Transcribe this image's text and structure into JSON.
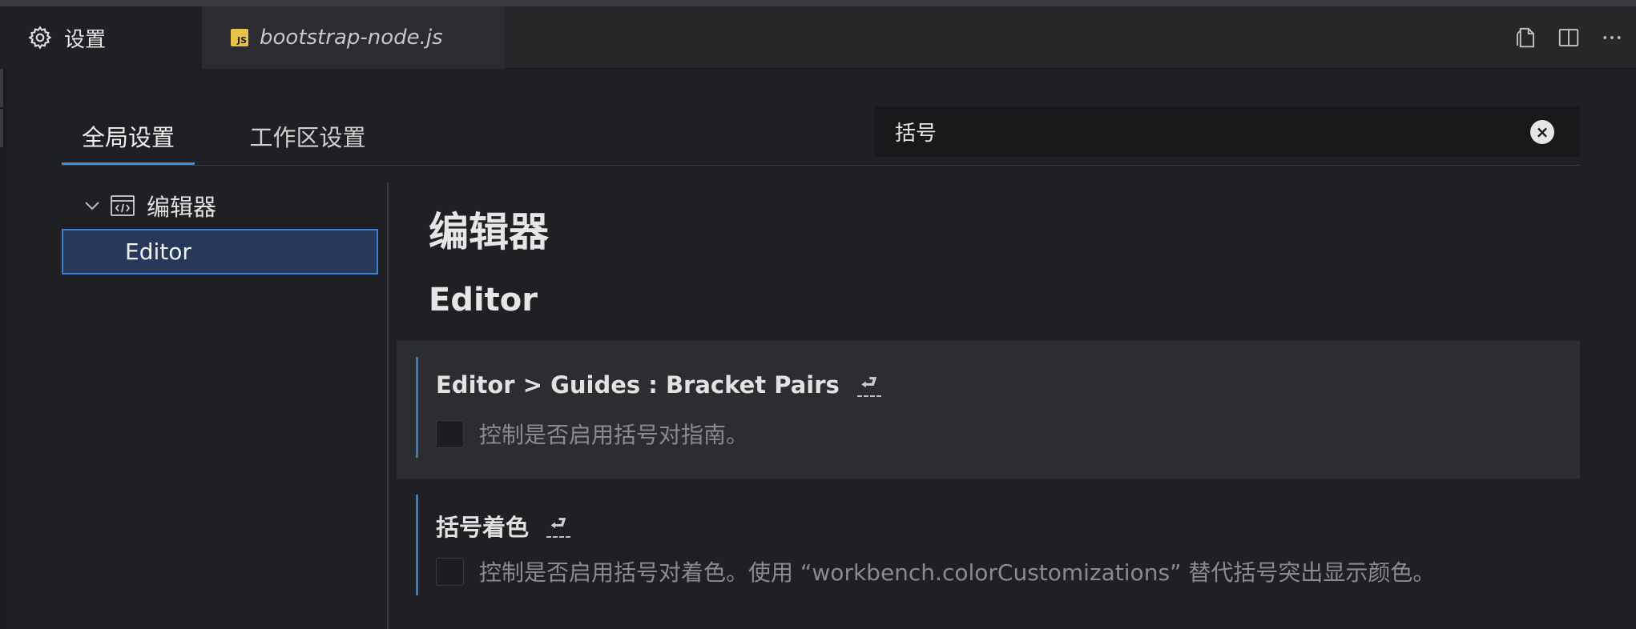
{
  "tabs": {
    "settings_label": "设置",
    "file_label": "bootstrap-node.js",
    "file_badge": "JS"
  },
  "scope": {
    "global": "全局设置",
    "workspace": "工作区设置"
  },
  "search": {
    "value": "括号",
    "clear_icon": "×"
  },
  "toc": {
    "group_label": "编辑器",
    "item_label": "Editor"
  },
  "content": {
    "category": "编辑器",
    "section": "Editor",
    "settings": [
      {
        "title": "Editor > Guides : Bracket Pairs",
        "description": "控制是否启用括号对指南。",
        "checked": false
      },
      {
        "title": "括号着色",
        "description": "控制是否启用括号对着色。使用 “workbench.colorCustomizations” 替代括号突出显示颜色。",
        "checked": false
      }
    ]
  },
  "colors": {
    "accent": "#3b8eea",
    "selected_bg": "#27395a",
    "modified_bar": "#3a7bb8"
  }
}
